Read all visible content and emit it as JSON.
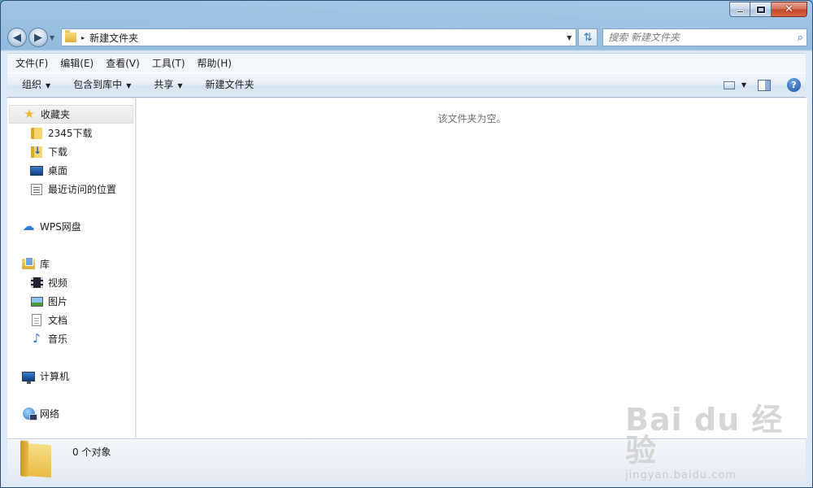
{
  "window": {
    "caption_buttons": {
      "minimize": "–",
      "maximize": "□",
      "close": "✕"
    }
  },
  "nav": {
    "back": "◀",
    "forward": "▶",
    "history": "▼"
  },
  "address": {
    "path": "新建文件夹",
    "separator": "▸",
    "dropdown": "▼"
  },
  "refresh": {
    "glyph": "⇅"
  },
  "search": {
    "placeholder": "搜索 新建文件夹",
    "value": ""
  },
  "menu": [
    {
      "label": "文件(F)"
    },
    {
      "label": "编辑(E)"
    },
    {
      "label": "查看(V)"
    },
    {
      "label": "工具(T)"
    },
    {
      "label": "帮助(H)"
    }
  ],
  "commands": {
    "organize": "组织",
    "include_in_library": "包含到库中",
    "share": "共享",
    "new_folder": "新建文件夹",
    "help": "?"
  },
  "sidebar": {
    "favorites": {
      "label": "收藏夹",
      "items": [
        {
          "label": "2345下载",
          "icon": "folder-icon"
        },
        {
          "label": "下载",
          "icon": "downloads-icon"
        },
        {
          "label": "桌面",
          "icon": "desktop-icon"
        },
        {
          "label": "最近访问的位置",
          "icon": "recent-places-icon"
        }
      ]
    },
    "wps": {
      "label": "WPS网盘",
      "icon": "cloud-icon"
    },
    "libraries": {
      "label": "库",
      "items": [
        {
          "label": "视频",
          "icon": "video-icon"
        },
        {
          "label": "图片",
          "icon": "pictures-icon"
        },
        {
          "label": "文档",
          "icon": "documents-icon"
        },
        {
          "label": "音乐",
          "icon": "music-icon"
        }
      ]
    },
    "computer": {
      "label": "计算机",
      "icon": "computer-icon"
    },
    "network": {
      "label": "网络",
      "icon": "network-icon"
    }
  },
  "content": {
    "empty_message": "该文件夹为空。"
  },
  "details": {
    "item_count": "0 个对象"
  },
  "watermark": {
    "logo": "Bai du 经验",
    "url": "jingyan.baidu.com"
  },
  "colors": {
    "accent": "#2f6fb0",
    "command_bar": "#dfe9f5",
    "window_frame": "#8ab6d8"
  }
}
